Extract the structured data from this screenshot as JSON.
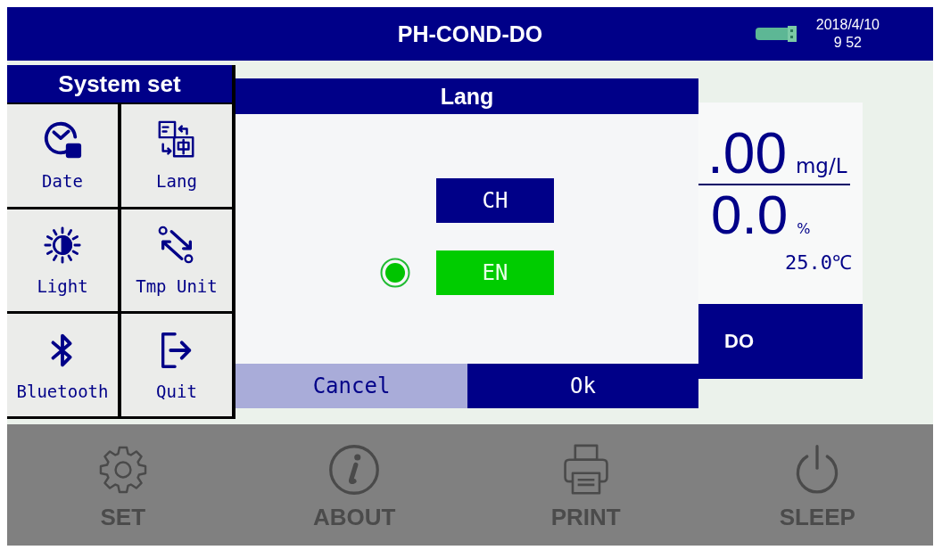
{
  "header": {
    "title": "PH-COND-DO",
    "date": "2018/4/10",
    "time": "9 52"
  },
  "system_set": {
    "title": "System set",
    "items": [
      {
        "label": "Date"
      },
      {
        "label": "Lang"
      },
      {
        "label": "Light"
      },
      {
        "label": "Tmp Unit"
      },
      {
        "label": "Bluetooth"
      },
      {
        "label": "Quit"
      }
    ]
  },
  "language_dialog": {
    "title": "Lang",
    "options": [
      {
        "label": "CH",
        "selected": false
      },
      {
        "label": "EN",
        "selected": true
      }
    ],
    "buttons": [
      {
        "label": "Cancel",
        "kind": "secondary"
      },
      {
        "label": "Ok",
        "kind": "primary"
      }
    ]
  },
  "measurement": {
    "value": ".00",
    "unit": "mg/L",
    "saturation": "0.0",
    "saturation_unit": "%",
    "temperature": "25.0℃",
    "mode": "DO"
  },
  "toolbar": [
    {
      "label": "SET"
    },
    {
      "label": "ABOUT"
    },
    {
      "label": "PRINT"
    },
    {
      "label": "SLEEP"
    }
  ]
}
